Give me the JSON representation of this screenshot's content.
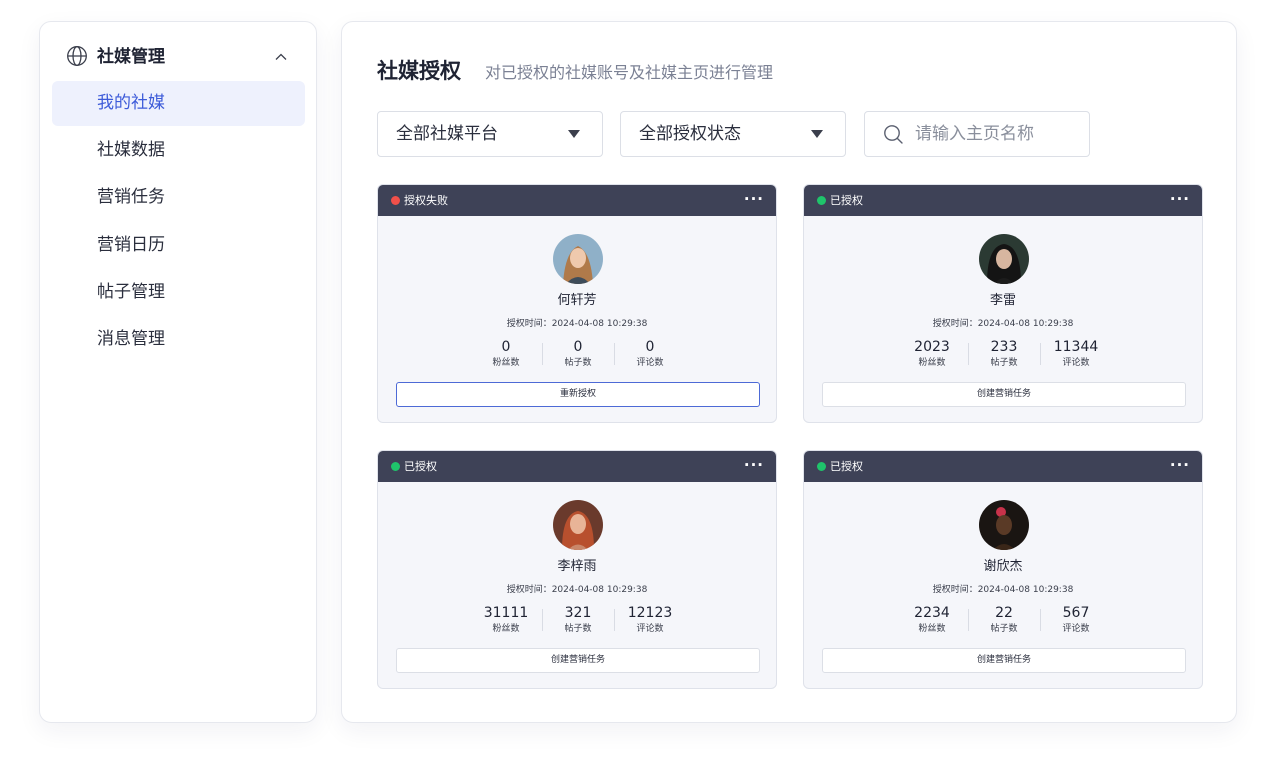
{
  "colors": {
    "accent": "#3d5bd9",
    "header_bg": "#3e4257",
    "fail": "#f1504a",
    "ok": "#1fc46b"
  },
  "sidebar": {
    "group_icon": "globe-icon",
    "group_title": "社媒管理",
    "items": [
      {
        "label": "我的社媒",
        "active": true
      },
      {
        "label": "社媒数据"
      },
      {
        "label": "营销任务"
      },
      {
        "label": "营销日历"
      },
      {
        "label": "帖子管理"
      },
      {
        "label": "消息管理"
      }
    ]
  },
  "main": {
    "title": "社媒授权",
    "subtitle": "对已授权的社媒账号及社媒主页进行管理",
    "filters": {
      "platform": "全部社媒平台",
      "status": "全部授权状态",
      "search_placeholder": "请输入主页名称"
    },
    "stat_labels": {
      "fans": "粉丝数",
      "posts": "帖子数",
      "comments": "评论数"
    },
    "cards": [
      {
        "status": "授权失败",
        "status_color": "#f1504a",
        "more": "···",
        "name": "何轩芳",
        "time": "授权时间：2024-04-08 10:29:38",
        "fans": "0",
        "posts": "0",
        "comments": "0",
        "action": "重新授权"
      },
      {
        "status": "已授权",
        "status_color": "#1fc46b",
        "more": "···",
        "name": "李雷",
        "time": "授权时间：2024-04-08 10:29:38",
        "fans": "2023",
        "posts": "233",
        "comments": "11344",
        "action": "创建营销任务"
      },
      {
        "status": "已授权",
        "status_color": "#1fc46b",
        "more": "···",
        "name": "李梓雨",
        "time": "授权时间：2024-04-08 10:29:38",
        "fans": "31111",
        "posts": "321",
        "comments": "12123",
        "action": "创建营销任务"
      },
      {
        "status": "已授权",
        "status_color": "#1fc46b",
        "more": "···",
        "name": "谢欣杰",
        "time": "授权时间：2024-04-08 10:29:38",
        "fans": "2234",
        "posts": "22",
        "comments": "567",
        "action": "创建营销任务"
      }
    ]
  }
}
